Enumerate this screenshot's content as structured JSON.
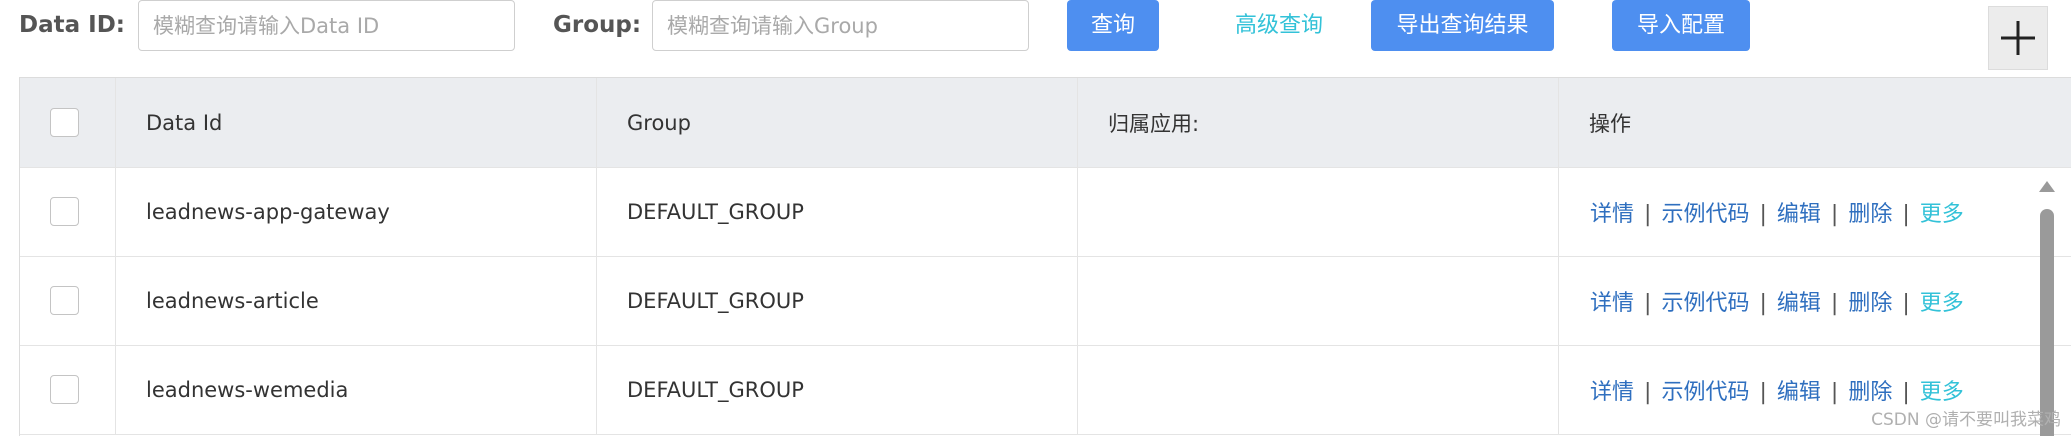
{
  "search": {
    "data_id_label": "Data ID:",
    "data_id_placeholder": "模糊查询请输入Data ID",
    "data_id_value": "",
    "group_label": "Group:",
    "group_placeholder": "模糊查询请输入Group",
    "group_value": "",
    "query_button": "查询",
    "advanced_query_link": "高级查询",
    "export_button": "导出查询结果",
    "import_button": "导入配置",
    "add_icon": "plus-icon"
  },
  "table": {
    "columns": [
      "Data Id",
      "Group",
      "归属应用:",
      "操作"
    ],
    "rows": [
      {
        "data_id": "leadnews-app-gateway",
        "group": "DEFAULT_GROUP",
        "app": ""
      },
      {
        "data_id": "leadnews-article",
        "group": "DEFAULT_GROUP",
        "app": ""
      },
      {
        "data_id": "leadnews-wemedia",
        "group": "DEFAULT_GROUP",
        "app": ""
      }
    ],
    "actions": {
      "details": "详情",
      "sample_code": "示例代码",
      "edit": "编辑",
      "delete": "删除",
      "more": "更多",
      "separator": "|"
    }
  },
  "watermark": "CSDN @请不要叫我菜鸡",
  "colors": {
    "primary_button": "#4e8ff0",
    "link_action": "#2f6fbf",
    "link_accent": "#33c2d8",
    "header_bg": "#ebedf0"
  }
}
